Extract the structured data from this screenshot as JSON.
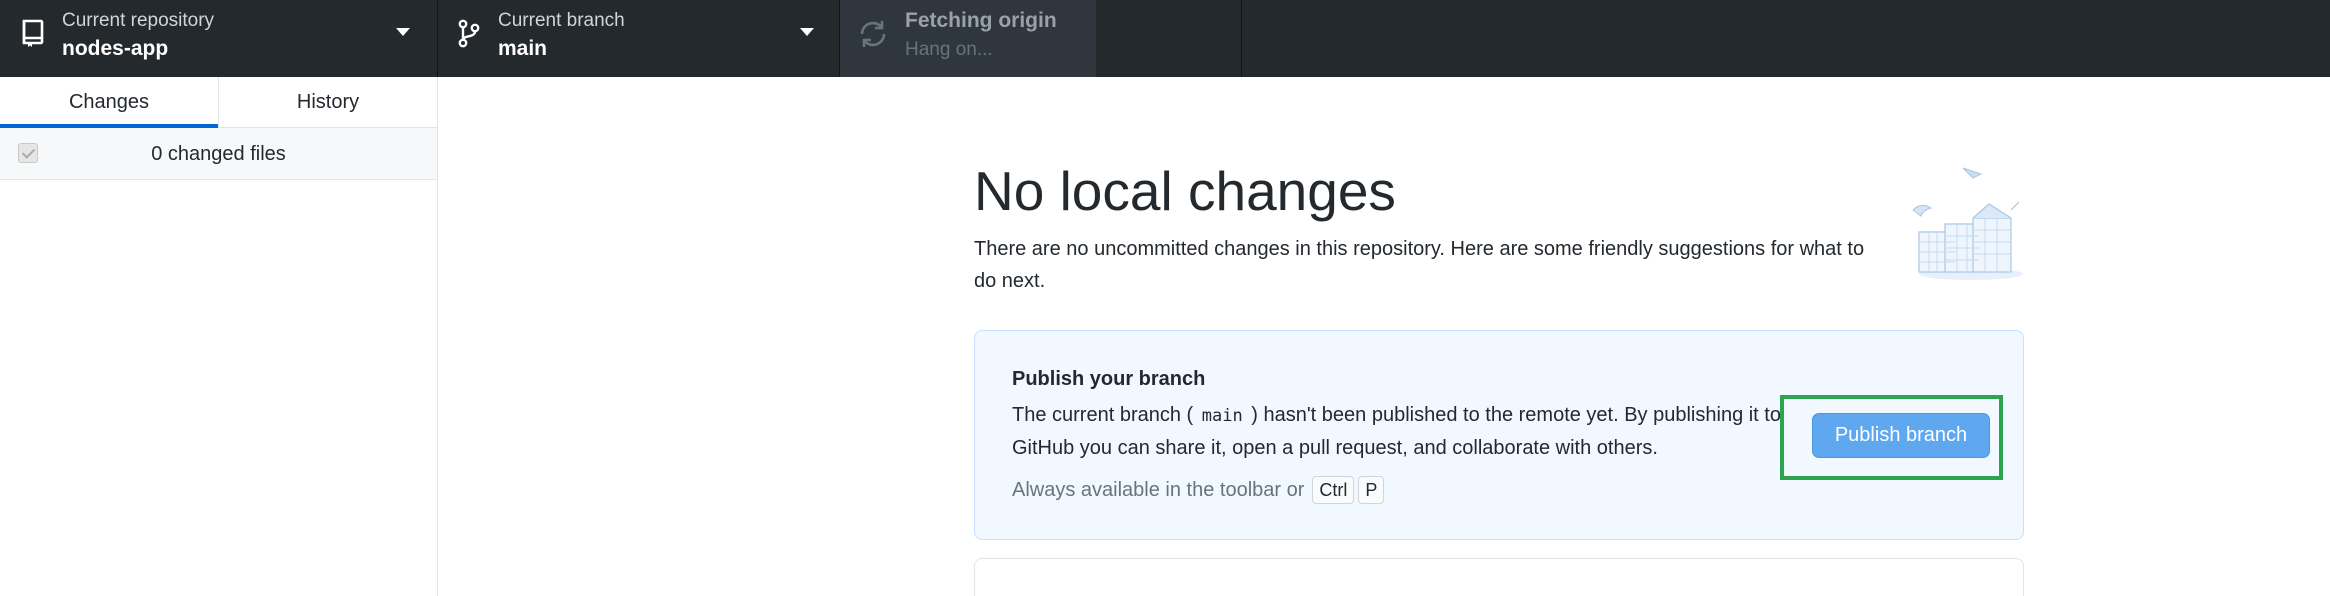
{
  "toolbar": {
    "repository": {
      "label": "Current repository",
      "value": "nodes-app"
    },
    "branch": {
      "label": "Current branch",
      "value": "main"
    },
    "fetch": {
      "label": "Fetching origin",
      "status": "Hang on..."
    }
  },
  "sidebar": {
    "tabs": [
      {
        "label": "Changes",
        "active": true
      },
      {
        "label": "History",
        "active": false
      }
    ],
    "changes_count": "0 changed files"
  },
  "main": {
    "heading": "No local changes",
    "intro": "There are no uncommitted changes in this repository. Here are some friendly suggestions for what to do next.",
    "publish_card": {
      "title": "Publish your branch",
      "desc_before": "The current branch (",
      "branch_code": "main",
      "desc_after": ") hasn't been published to the remote yet. By publishing it to GitHub you can share it, open a pull request, and collaborate with others.",
      "hint": "Always available in the toolbar or",
      "shortcut_keys": [
        "Ctrl",
        "P"
      ],
      "button_label": "Publish branch"
    }
  },
  "colors": {
    "toolbar_bg": "#24292e",
    "accent": "#0366d6",
    "card_bg": "#f1f8ff",
    "button_bg": "#5fa8f0",
    "highlight": "#2ea44f"
  }
}
